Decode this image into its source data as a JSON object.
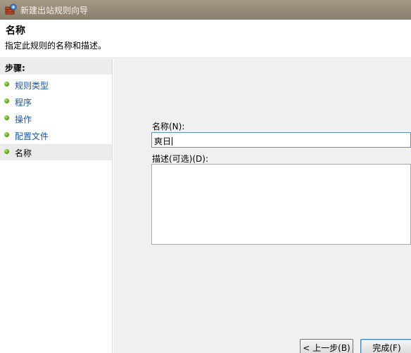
{
  "window": {
    "title": "新建出站规则向导",
    "icon": "firewall-wizard-icon"
  },
  "header": {
    "title": "名称",
    "subtitle": "指定此规则的名称和描述。"
  },
  "sidebar": {
    "title": "步骤:",
    "items": [
      {
        "label": "规则类型"
      },
      {
        "label": "程序"
      },
      {
        "label": "操作"
      },
      {
        "label": "配置文件"
      },
      {
        "label": "名称"
      }
    ],
    "active_index": 4
  },
  "form": {
    "name_label": "名称(N):",
    "name_value": "爽日",
    "description_label": "描述(可选)(D):",
    "description_value": ""
  },
  "buttons": {
    "back": "< 上一步(B)",
    "finish": "完成(F)"
  },
  "colors": {
    "titlebar": "#9a8f7b",
    "link": "#1a56a8",
    "step_dot": "#5aad1c",
    "input_focus": "#5b93c9"
  }
}
